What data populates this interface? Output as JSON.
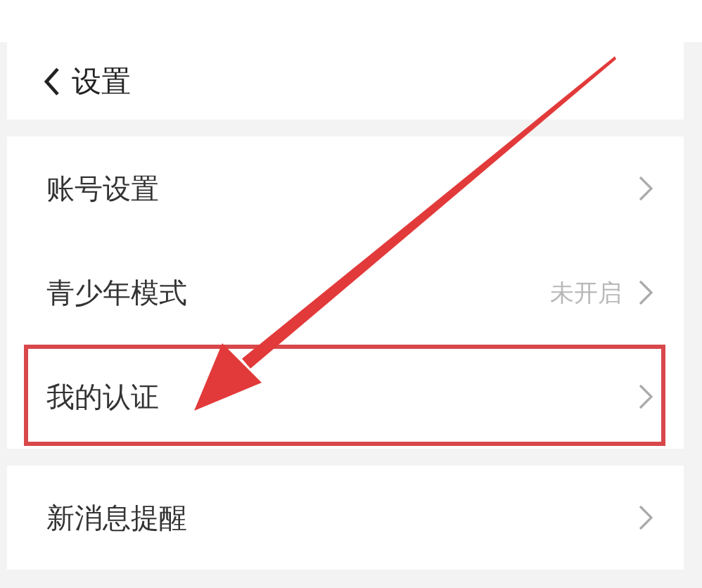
{
  "header": {
    "title": "设置"
  },
  "groups": [
    {
      "items": [
        {
          "label": "账号设置",
          "highlighted": false
        },
        {
          "label": "青少年模式",
          "value": "未开启",
          "highlighted": false
        },
        {
          "label": "我的认证",
          "highlighted": true
        }
      ]
    },
    {
      "items": [
        {
          "label": "新消息提醒",
          "highlighted": false
        }
      ]
    }
  ]
}
